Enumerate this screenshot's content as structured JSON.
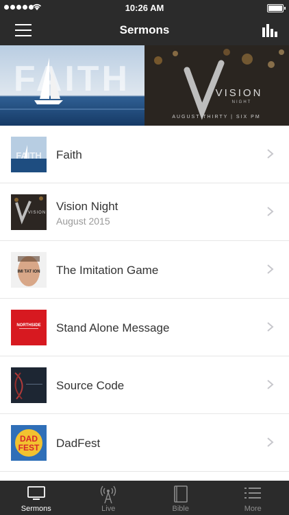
{
  "status": {
    "time": "10:26 AM"
  },
  "nav": {
    "title": "Sermons"
  },
  "banner": {
    "left_text": "FAITH",
    "right_text": "VISION",
    "right_sub": "NIGHT",
    "right_caption": "AUGUST THIRTY | SIX PM"
  },
  "sermons": [
    {
      "title": "Faith",
      "subtitle": ""
    },
    {
      "title": "Vision Night",
      "subtitle": "August 2015"
    },
    {
      "title": "The Imitation Game",
      "subtitle": ""
    },
    {
      "title": "Stand Alone Message",
      "subtitle": ""
    },
    {
      "title": "Source Code",
      "subtitle": ""
    },
    {
      "title": "DadFest",
      "subtitle": ""
    }
  ],
  "thumbs": {
    "imitation": "IMI TAT ION",
    "northside": "NORTHSIDE",
    "dad": "DAD",
    "fest": "FEST"
  },
  "tabs": [
    {
      "label": "Sermons",
      "icon": "tv-icon",
      "active": true
    },
    {
      "label": "Live",
      "icon": "broadcast-icon",
      "active": false
    },
    {
      "label": "Bible",
      "icon": "book-icon",
      "active": false
    },
    {
      "label": "More",
      "icon": "list-icon",
      "active": false
    }
  ],
  "colors": {
    "bar": "#2b2b2b",
    "active_tab": "#ffffff",
    "inactive_tab": "#8e8e8e"
  }
}
